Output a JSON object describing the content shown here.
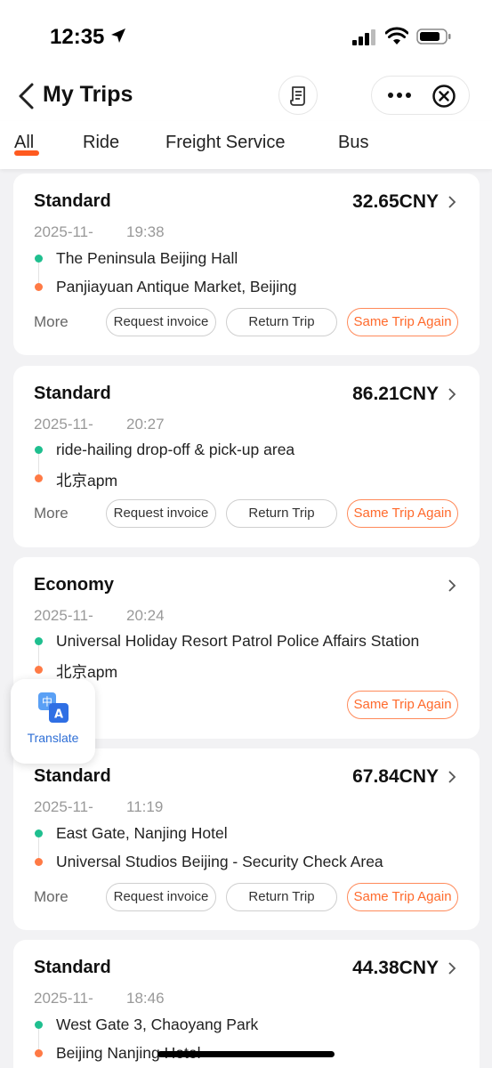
{
  "status_bar": {
    "time": "12:35"
  },
  "nav": {
    "title": "My Trips"
  },
  "tabs": [
    {
      "label": "All"
    },
    {
      "label": "Ride"
    },
    {
      "label": "Freight Service"
    },
    {
      "label": "Bus"
    }
  ],
  "colors": {
    "accent": "#ff5a1f",
    "origin_dot": "#1fbf8f",
    "dest_dot": "#ff7a45",
    "translate_text": "#2f6fd6"
  },
  "trips": [
    {
      "car_type": "Standard",
      "price": "32.65CNY",
      "date": "2025-11-",
      "time": "19:38",
      "origin": "The Peninsula Beijing Hall",
      "destination": "Panjiayuan Antique Market, Beijing",
      "more": "More",
      "btn_invoice": "Request invoice",
      "btn_return": "Return Trip",
      "btn_again": "Same Trip Again"
    },
    {
      "car_type": "Standard",
      "price": "86.21CNY",
      "date": "2025-11-",
      "time": "20:27",
      "origin": "ride-hailing drop-off & pick-up area",
      "destination": "北京apm",
      "more": "More",
      "btn_invoice": "Request invoice",
      "btn_return": "Return Trip",
      "btn_again": "Same Trip Again"
    },
    {
      "car_type": "Economy",
      "date": "2025-11-",
      "time": "20:24",
      "origin": "Universal Holiday Resort Patrol Police Affairs Station",
      "destination": "北京apm",
      "btn_again": "Same Trip Again"
    },
    {
      "car_type": "Standard",
      "price": "67.84CNY",
      "date": "2025-11-",
      "time": "11:19",
      "origin": "East Gate, Nanjing Hotel",
      "destination": "Universal Studios Beijing - Security Check Area",
      "more": "More",
      "btn_invoice": "Request invoice",
      "btn_return": "Return Trip",
      "btn_again": "Same Trip Again"
    },
    {
      "car_type": "Standard",
      "price": "44.38CNY",
      "date": "2025-11-",
      "time": "18:46",
      "origin": "West Gate 3, Chaoyang Park",
      "destination": "Beijing Nanjing Hotel"
    }
  ],
  "translate": {
    "label": "Translate",
    "glyph_zh": "中",
    "glyph_en": "A"
  }
}
